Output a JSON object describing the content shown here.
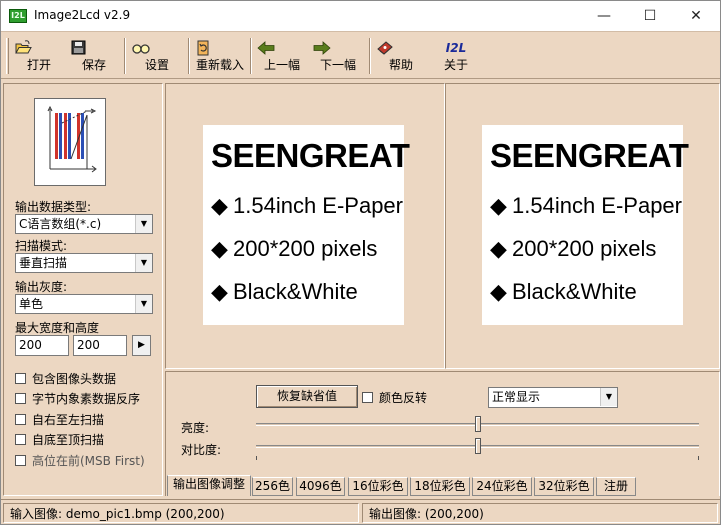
{
  "window": {
    "title": "Image2Lcd v2.9",
    "app_icon_text": "I2L",
    "minimize_glyph": "—",
    "maximize_glyph": "☐",
    "close_glyph": "✕"
  },
  "toolbar": {
    "open": "打开",
    "save": "保存",
    "settings": "设置",
    "reload": "重新载入",
    "prev": "上一幅",
    "next": "下一幅",
    "help": "帮助",
    "about": "关于",
    "about_icon_text": "I2L"
  },
  "left": {
    "output_type_label": "输出数据类型:",
    "output_type_value": "C语言数组(*.c)",
    "scan_mode_label": "扫描模式:",
    "scan_mode_value": "垂直扫描",
    "gray_label": "输出灰度:",
    "gray_value": "单色",
    "max_size_label": "最大宽度和高度",
    "max_width": "200",
    "max_height": "200",
    "spin_glyph": "▶",
    "combo_arrow": "▼",
    "checkboxes": [
      "包含图像头数据",
      "字节内象素数据反序",
      "自右至左扫描",
      "自底至顶扫描",
      "高位在前(MSB First)"
    ]
  },
  "image": {
    "heading": "SEENGREAT",
    "bullet": "◆",
    "lines": [
      "1.54inch E-Paper",
      "200*200 pixels",
      "Black&White"
    ]
  },
  "adjust": {
    "restore_button": "恢复缺省值",
    "invert_label": "颜色反转",
    "display_mode": "正常显示",
    "brightness_label": "亮度:",
    "contrast_label": "对比度:",
    "brightness_value": 0.5,
    "contrast_value": 0.5
  },
  "tabs": [
    "输出图像调整",
    "256色",
    "4096色",
    "16位彩色",
    "18位彩色",
    "24位彩色",
    "32位彩色",
    "注册"
  ],
  "status": {
    "input": "输入图像: demo_pic1.bmp (200,200)",
    "output": "输出图像: (200,200)"
  }
}
